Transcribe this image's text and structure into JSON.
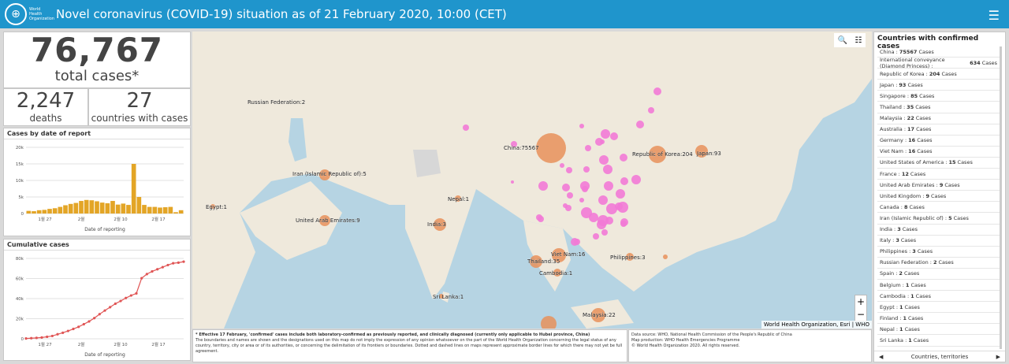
{
  "header": {
    "title": "Novel coronavirus (COVID-19) situation as of 21 February 2020, 10:00 (CET)",
    "logo_text": "World Health Organization"
  },
  "stats": {
    "total_value": "76,767",
    "total_label": "total cases*",
    "deaths_value": "2,247",
    "deaths_label": "deaths",
    "countries_value": "27",
    "countries_label": "countries with cases"
  },
  "daily_chart_title": "Cases by date of report",
  "cumulative_chart_title": "Cumulative cases",
  "chart_data": [
    {
      "type": "bar",
      "title": "Cases by date of report",
      "xlabel": "Date of reporting",
      "ylabel": "",
      "ylim": [
        0,
        20000
      ],
      "yticks": [
        "0",
        "5k",
        "10k",
        "15k",
        "20k"
      ],
      "xticks": [
        "1월 27",
        "2월",
        "2월 10",
        "2월 17"
      ],
      "values": [
        800,
        700,
        1000,
        1100,
        1400,
        1600,
        2000,
        2500,
        2900,
        3200,
        3800,
        4100,
        4000,
        3700,
        3300,
        3100,
        3800,
        2700,
        3000,
        2600,
        15000,
        5000,
        2600,
        2000,
        2000,
        1800,
        1900,
        2000,
        400,
        1000
      ],
      "color": "#e3a526"
    },
    {
      "type": "line",
      "title": "Cumulative cases",
      "xlabel": "Date of reporting",
      "ylabel": "",
      "ylim": [
        0,
        80000
      ],
      "yticks": [
        "0",
        "20k",
        "40k",
        "60k",
        "80k"
      ],
      "xticks": [
        "1월 27",
        "2월",
        "2월 10",
        "2월 17"
      ],
      "values": [
        300,
        600,
        900,
        1300,
        2000,
        2800,
        4500,
        6000,
        7800,
        9800,
        11900,
        14500,
        17300,
        20600,
        24500,
        28100,
        31500,
        34900,
        37600,
        40600,
        43100,
        45200,
        60300,
        64400,
        67100,
        69200,
        71300,
        73400,
        75200,
        75800,
        76767
      ],
      "color": "#e05555"
    }
  ],
  "map": {
    "labels": [
      {
        "text": "Russian Federation:2"
      },
      {
        "text": "Iran (Islamic Republic of):5"
      },
      {
        "text": "Egypt:1"
      },
      {
        "text": "United Arab Emirates:9"
      },
      {
        "text": "Nepal:1"
      },
      {
        "text": "India:3"
      },
      {
        "text": "Sri Lanka:1"
      },
      {
        "text": "China:75567"
      },
      {
        "text": "Republic of Korea:204"
      },
      {
        "text": "Japan:93"
      },
      {
        "text": "Thailand:35"
      },
      {
        "text": "Viet Nam:16"
      },
      {
        "text": "Cambodia:1"
      },
      {
        "text": "Philippines:3"
      },
      {
        "text": "Malaysia:22"
      }
    ],
    "attribution": "World Health Organization, Esri | WHO",
    "zoom_in": "+",
    "zoom_out": "−"
  },
  "notes": {
    "line1": "* Effective 17 February, 'confirmed' cases include both laboratory-confirmed as previously reported, and clinically diagnosed (currently only applicable to Hubei province, China)",
    "line2": "The boundaries and names are shown and the designations used on this map do not imply the expression of any opinion whatsoever on the part of the World Health Organization concerning the legal status of any country, territory, city or area or of its authorities, or concerning the delimitation of its frontiers or boundaries. Dotted and dashed lines on maps represent approximate border lines for which there may not yet be full agreement."
  },
  "source": {
    "line1": "Data source: WHO, National Health Commission of the People's Republic of China",
    "line2": "Map production: WHO Health Emergencies Programme",
    "line3": "© World Health Organization 2020. All rights reserved."
  },
  "country_list": {
    "title": "Countries with confirmed cases",
    "footer": "Countries, territories",
    "items": [
      {
        "name": "China :",
        "count": "75567",
        "suffix": "Cases"
      },
      {
        "name": "International conveyance (Diamond Princess) :",
        "count": "634",
        "suffix": "Cases"
      },
      {
        "name": "Republic of Korea :",
        "count": "204",
        "suffix": "Cases"
      },
      {
        "name": "Japan :",
        "count": "93",
        "suffix": "Cases"
      },
      {
        "name": "Singapore :",
        "count": "85",
        "suffix": "Cases"
      },
      {
        "name": "Thailand :",
        "count": "35",
        "suffix": "Cases"
      },
      {
        "name": "Malaysia :",
        "count": "22",
        "suffix": "Cases"
      },
      {
        "name": "Australia :",
        "count": "17",
        "suffix": "Cases"
      },
      {
        "name": "Germany :",
        "count": "16",
        "suffix": "Cases"
      },
      {
        "name": "Viet Nam :",
        "count": "16",
        "suffix": "Cases"
      },
      {
        "name": "United States of America :",
        "count": "15",
        "suffix": "Cases"
      },
      {
        "name": "France :",
        "count": "12",
        "suffix": "Cases"
      },
      {
        "name": "United Arab Emirates :",
        "count": "9",
        "suffix": "Cases"
      },
      {
        "name": "United Kingdom :",
        "count": "9",
        "suffix": "Cases"
      },
      {
        "name": "Canada :",
        "count": "8",
        "suffix": "Cases"
      },
      {
        "name": "Iran (Islamic Republic of) :",
        "count": "5",
        "suffix": "Cases"
      },
      {
        "name": "India :",
        "count": "3",
        "suffix": "Cases"
      },
      {
        "name": "Italy :",
        "count": "3",
        "suffix": "Cases"
      },
      {
        "name": "Philippines :",
        "count": "3",
        "suffix": "Cases"
      },
      {
        "name": "Russian Federation :",
        "count": "2",
        "suffix": "Cases"
      },
      {
        "name": "Spain :",
        "count": "2",
        "suffix": "Cases"
      },
      {
        "name": "Belgium :",
        "count": "1",
        "suffix": "Cases"
      },
      {
        "name": "Cambodia :",
        "count": "1",
        "suffix": "Cases"
      },
      {
        "name": "Egypt :",
        "count": "1",
        "suffix": "Cases"
      },
      {
        "name": "Finland :",
        "count": "1",
        "suffix": "Cases"
      },
      {
        "name": "Nepal :",
        "count": "1",
        "suffix": "Cases"
      },
      {
        "name": "Sri Lanka :",
        "count": "1",
        "suffix": "Cases"
      }
    ]
  }
}
